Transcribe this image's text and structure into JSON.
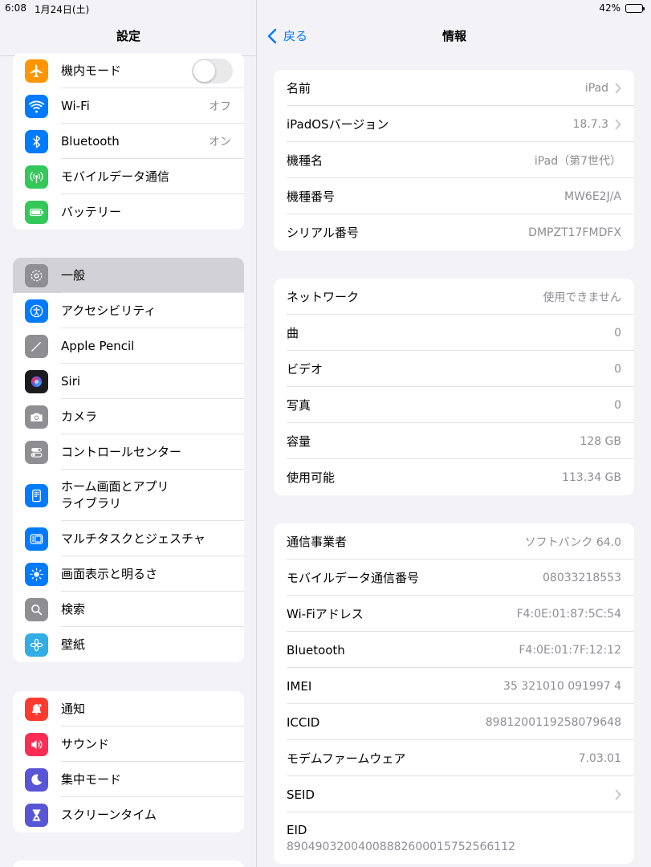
{
  "status_bar": {
    "time": "6:08",
    "date": "1月24日(土)",
    "battery": "42%",
    "battery_level": 0.42
  },
  "sidebar": {
    "title": "設定",
    "groups": [
      [
        {
          "label": "機内モード",
          "icon": "airplane-icon",
          "color": "#ff9500",
          "toggle": false
        },
        {
          "label": "Wi-Fi",
          "value": "オフ",
          "icon": "wifi-icon",
          "color": "#007aff"
        },
        {
          "label": "Bluetooth",
          "value": "オン",
          "icon": "bluetooth-icon",
          "color": "#007aff"
        },
        {
          "label": "モバイルデータ通信",
          "icon": "cellular-icon",
          "color": "#34c759"
        },
        {
          "label": "バッテリー",
          "icon": "battery-icon",
          "color": "#34c759"
        }
      ],
      [
        {
          "label": "一般",
          "icon": "gear-icon",
          "color": "#8e8e93",
          "selected": true
        },
        {
          "label": "アクセシビリティ",
          "icon": "accessibility-icon",
          "color": "#007aff"
        },
        {
          "label": "Apple Pencil",
          "icon": "pencil-icon",
          "color": "#8e8e93"
        },
        {
          "label": "Siri",
          "icon": "siri-icon",
          "color": "#1c1c1e"
        },
        {
          "label": "カメラ",
          "icon": "camera-icon",
          "color": "#8e8e93"
        },
        {
          "label": "コントロールセンター",
          "icon": "control-center-icon",
          "color": "#8e8e93"
        },
        {
          "label": "ホーム画面とアプリ\nライブラリ",
          "icon": "home-screen-icon",
          "color": "#007aff"
        },
        {
          "label": "マルチタスクとジェスチャ",
          "icon": "multitasking-icon",
          "color": "#007aff"
        },
        {
          "label": "画面表示と明るさ",
          "icon": "brightness-icon",
          "color": "#007aff"
        },
        {
          "label": "検索",
          "icon": "search-icon",
          "color": "#8e8e93"
        },
        {
          "label": "壁紙",
          "icon": "wallpaper-icon",
          "color": "#32ade6"
        }
      ],
      [
        {
          "label": "通知",
          "icon": "notification-icon",
          "color": "#ff3b30"
        },
        {
          "label": "サウンド",
          "icon": "sound-icon",
          "color": "#ff2d55"
        },
        {
          "label": "集中モード",
          "icon": "focus-icon",
          "color": "#5856d6"
        },
        {
          "label": "スクリーンタイム",
          "icon": "screen-time-icon",
          "color": "#5856d6"
        }
      ]
    ]
  },
  "main": {
    "back_label": "戻る",
    "title": "情報",
    "sections": [
      [
        {
          "key": "名前",
          "value": "iPad",
          "chevron": true
        },
        {
          "key": "iPadOSバージョン",
          "value": "18.7.3",
          "chevron": true
        },
        {
          "key": "機種名",
          "value": "iPad（第7世代）"
        },
        {
          "key": "機種番号",
          "value": "MW6E2J/A"
        },
        {
          "key": "シリアル番号",
          "value": "DMPZT17FMDFX"
        }
      ],
      [
        {
          "key": "ネットワーク",
          "value": "使用できません"
        },
        {
          "key": "曲",
          "value": "0"
        },
        {
          "key": "ビデオ",
          "value": "0"
        },
        {
          "key": "写真",
          "value": "0"
        },
        {
          "key": "容量",
          "value": "128 GB"
        },
        {
          "key": "使用可能",
          "value": "113.34 GB"
        }
      ],
      [
        {
          "key": "通信事業者",
          "value": "ソフトバンク 64.0"
        },
        {
          "key": "モバイルデータ通信番号",
          "value": "08033218553"
        },
        {
          "key": "Wi-Fiアドレス",
          "value": "F4:0E:01:87:5C:54"
        },
        {
          "key": "Bluetooth",
          "value": "F4:0E:01:7F:12:12"
        },
        {
          "key": "IMEI",
          "value": "35 321010 091997 4"
        },
        {
          "key": "ICCID",
          "value": "8981200119258079648"
        },
        {
          "key": "モデムファームウェア",
          "value": "7.03.01"
        },
        {
          "key": "SEID",
          "value": "",
          "chevron": true
        },
        {
          "key": "EID",
          "value": "89049032004008882600015752566112",
          "stacked": true
        }
      ]
    ]
  }
}
